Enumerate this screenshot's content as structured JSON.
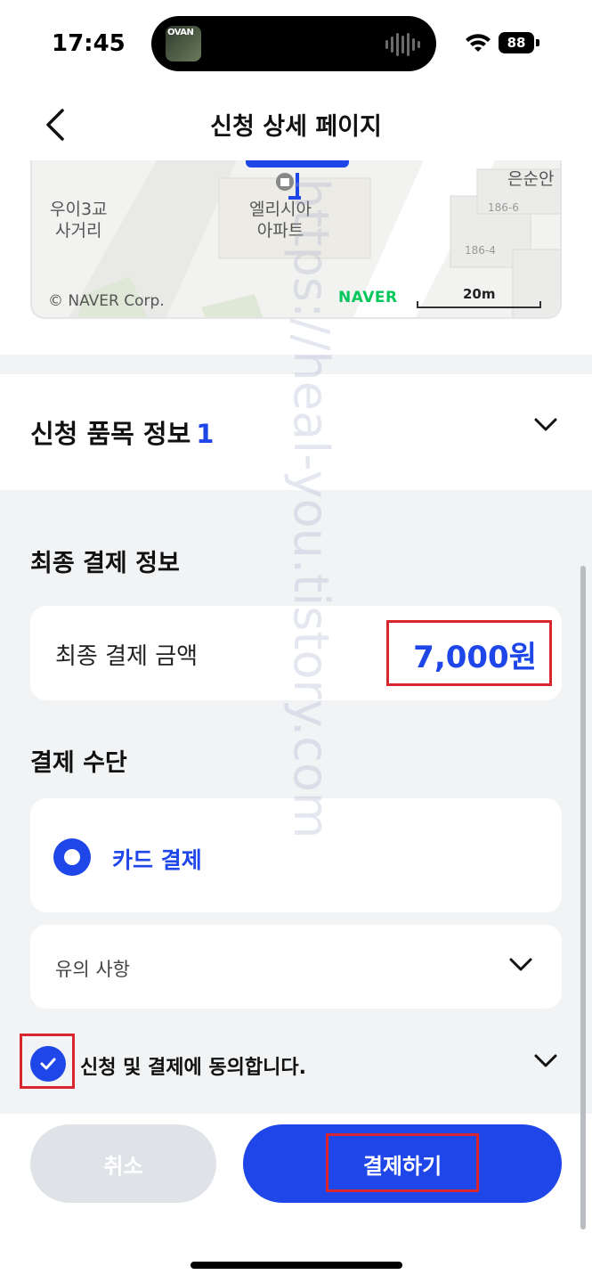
{
  "status_bar": {
    "time": "17:45",
    "media_thumb_label": "OVAN",
    "battery": "88",
    "icons": [
      "wifi-icon",
      "battery-icon",
      "waveform-icon"
    ]
  },
  "header": {
    "title": "신청 상세 페이지",
    "back_icon": "chevron-left-icon"
  },
  "map": {
    "labels": {
      "intersection": "우이3교\n사거리",
      "apartment": "엘리시아\n아파트",
      "place": "은순안",
      "lot1": "186-6",
      "lot2": "186-4"
    },
    "copyright": "© NAVER Corp.",
    "brand": "NAVER",
    "scale": "20m"
  },
  "items_section": {
    "title": "신청 품목 정보",
    "count": "1"
  },
  "payment_info": {
    "heading": "최종 결제 정보",
    "amount_label": "최종 결제 금액",
    "amount_value": "7,000원"
  },
  "payment_method": {
    "heading": "결제 수단",
    "selected": "카드 결제"
  },
  "notice": {
    "label": "유의 사항"
  },
  "agreement": {
    "text": "신청 및 결제에 동의합니다.",
    "checked": true
  },
  "buttons": {
    "cancel": "취소",
    "pay": "결제하기"
  },
  "watermark": "https://heal-you.tistory.com",
  "colors": {
    "accent": "#1e46e8",
    "highlight": "#d9262e",
    "background_gray": "#f1f3f5",
    "cancel_gray": "#dfe3e8",
    "naver_green": "#03c75a"
  }
}
